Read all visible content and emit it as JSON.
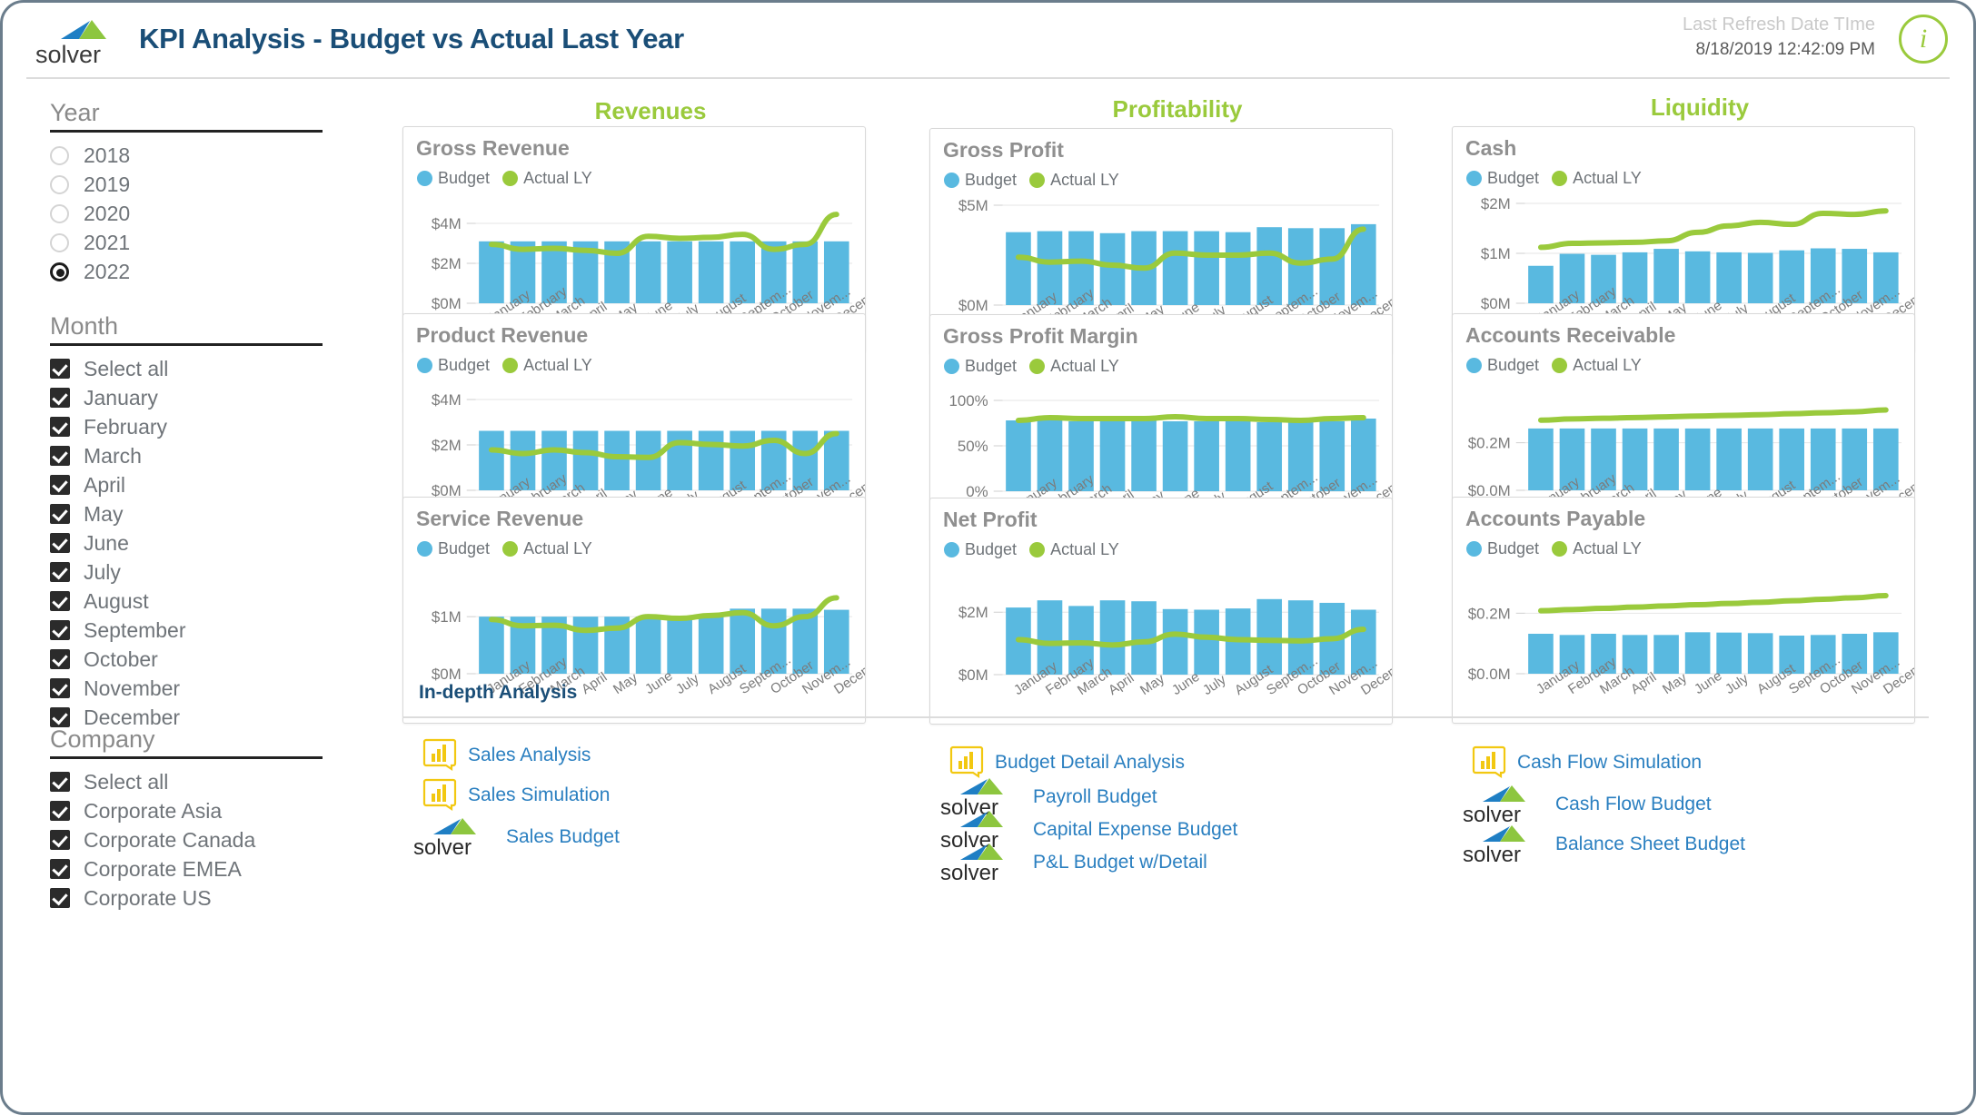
{
  "header": {
    "title": "KPI Analysis - Budget vs Actual Last Year",
    "brand": "solver",
    "refresh_label": "Last Refresh Date TIme",
    "refresh_value": "8/18/2019 12:42:09 PM",
    "info_icon": "info-icon",
    "info_glyph": "i"
  },
  "colors": {
    "budget_bar": "#59B9E0",
    "actual_line": "#9ACA3C",
    "section_header": "#9ACA3C",
    "title_blue": "#1a4e77",
    "link_blue": "#2a7fc0",
    "card_title": "#8f8f8f",
    "powerbi_yellow": "#F2C811"
  },
  "sidebar": {
    "year": {
      "title": "Year",
      "type": "radio",
      "options": [
        {
          "label": "2018",
          "selected": false
        },
        {
          "label": "2019",
          "selected": false
        },
        {
          "label": "2020",
          "selected": false
        },
        {
          "label": "2021",
          "selected": false
        },
        {
          "label": "2022",
          "selected": true
        }
      ]
    },
    "month": {
      "title": "Month",
      "type": "checkbox",
      "options": [
        {
          "label": "Select all",
          "checked": true
        },
        {
          "label": "January",
          "checked": true
        },
        {
          "label": "February",
          "checked": true
        },
        {
          "label": "March",
          "checked": true
        },
        {
          "label": "April",
          "checked": true
        },
        {
          "label": "May",
          "checked": true
        },
        {
          "label": "June",
          "checked": true
        },
        {
          "label": "July",
          "checked": true
        },
        {
          "label": "August",
          "checked": true
        },
        {
          "label": "September",
          "checked": true
        },
        {
          "label": "October",
          "checked": true
        },
        {
          "label": "November",
          "checked": true
        },
        {
          "label": "December",
          "checked": true
        }
      ]
    },
    "company": {
      "title": "Company",
      "type": "checkbox",
      "options": [
        {
          "label": "Select all",
          "checked": true
        },
        {
          "label": "Corporate Asia",
          "checked": true
        },
        {
          "label": "Corporate Canada",
          "checked": true
        },
        {
          "label": "Corporate EMEA",
          "checked": true
        },
        {
          "label": "Corporate US",
          "checked": true
        }
      ]
    }
  },
  "sections": [
    {
      "label": "Revenues"
    },
    {
      "label": "Profitability"
    },
    {
      "label": "Liquidity"
    }
  ],
  "legend": {
    "budget": "Budget",
    "actual": "Actual LY"
  },
  "x_categories": [
    "January",
    "February",
    "March",
    "April",
    "May",
    "June",
    "July",
    "August",
    "Septem...",
    "October",
    "Novem...",
    "Decem..."
  ],
  "chart_data": [
    {
      "id": "gross-revenue",
      "type": "bar",
      "title": "Gross Revenue",
      "section": "Revenues",
      "categories": [
        "January",
        "February",
        "March",
        "April",
        "May",
        "June",
        "July",
        "August",
        "Septem...",
        "October",
        "Novem...",
        "Decem..."
      ],
      "series": [
        {
          "name": "Budget",
          "type": "bar",
          "values": [
            3.1,
            3.1,
            3.1,
            3.1,
            3.1,
            3.1,
            3.1,
            3.1,
            3.1,
            3.1,
            3.1,
            3.1
          ]
        },
        {
          "name": "Actual LY",
          "type": "line",
          "values": [
            2.95,
            2.7,
            2.75,
            2.65,
            2.5,
            3.35,
            3.25,
            3.3,
            3.45,
            2.7,
            2.95,
            4.45
          ]
        }
      ],
      "ylim": [
        0,
        5
      ],
      "yticks": [
        0,
        2,
        4
      ],
      "yticklabels": [
        "$0M",
        "$2M",
        "$4M"
      ],
      "xlabel": "",
      "ylabel": "",
      "grid": true,
      "legend": "top-left"
    },
    {
      "id": "gross-profit",
      "type": "bar",
      "title": "Gross Profit",
      "section": "Profitability",
      "categories": [
        "January",
        "February",
        "March",
        "April",
        "May",
        "June",
        "July",
        "August",
        "Septem...",
        "October",
        "Novem...",
        "Decem..."
      ],
      "series": [
        {
          "name": "Budget",
          "type": "bar",
          "values": [
            3.65,
            3.7,
            3.7,
            3.6,
            3.7,
            3.7,
            3.7,
            3.65,
            3.9,
            3.85,
            3.85,
            4.05
          ]
        },
        {
          "name": "Actual LY",
          "type": "line",
          "values": [
            2.4,
            2.15,
            2.2,
            2.0,
            1.85,
            2.6,
            2.5,
            2.5,
            2.6,
            2.1,
            2.3,
            3.8
          ]
        }
      ],
      "ylim": [
        0,
        5
      ],
      "yticks": [
        0,
        5
      ],
      "yticklabels": [
        "$0M",
        "$5M"
      ],
      "xlabel": "",
      "ylabel": "",
      "grid": true,
      "legend": "top-left"
    },
    {
      "id": "cash",
      "type": "bar",
      "title": "Cash",
      "section": "Liquidity",
      "categories": [
        "January",
        "February",
        "March",
        "April",
        "May",
        "June",
        "July",
        "August",
        "Septem...",
        "October",
        "Novem...",
        "Decem..."
      ],
      "series": [
        {
          "name": "Budget",
          "type": "bar",
          "values": [
            0.75,
            0.99,
            0.97,
            1.02,
            1.09,
            1.04,
            1.02,
            1.01,
            1.06,
            1.1,
            1.09,
            1.02
          ]
        },
        {
          "name": "Actual LY",
          "type": "line",
          "values": [
            1.12,
            1.2,
            1.21,
            1.22,
            1.25,
            1.42,
            1.55,
            1.62,
            1.58,
            1.8,
            1.78,
            1.85
          ]
        }
      ],
      "ylim": [
        0,
        2
      ],
      "yticks": [
        0,
        1,
        2
      ],
      "yticklabels": [
        "$0M",
        "$1M",
        "$2M"
      ],
      "xlabel": "",
      "ylabel": "",
      "grid": true,
      "legend": "top-left"
    },
    {
      "id": "product-revenue",
      "type": "bar",
      "title": "Product Revenue",
      "section": "Revenues",
      "categories": [
        "January",
        "February",
        "March",
        "April",
        "May",
        "June",
        "July",
        "August",
        "Septem...",
        "October",
        "Novem...",
        "Decem..."
      ],
      "series": [
        {
          "name": "Budget",
          "type": "bar",
          "values": [
            2.62,
            2.62,
            2.62,
            2.62,
            2.62,
            2.62,
            2.62,
            2.62,
            2.62,
            2.62,
            2.62,
            2.62
          ]
        },
        {
          "name": "Actual LY",
          "type": "line",
          "values": [
            1.78,
            1.62,
            1.78,
            1.66,
            1.48,
            1.45,
            2.1,
            2.02,
            1.95,
            2.2,
            1.62,
            2.5
          ]
        }
      ],
      "ylim": [
        0,
        4.4
      ],
      "yticks": [
        0,
        2,
        4
      ],
      "yticklabels": [
        "$0M",
        "$2M",
        "$4M"
      ],
      "xlabel": "",
      "ylabel": "",
      "grid": true,
      "legend": "top-left"
    },
    {
      "id": "gross-profit-margin",
      "type": "bar",
      "title": "Gross Profit Margin",
      "section": "Profitability",
      "categories": [
        "January",
        "February",
        "March",
        "April",
        "May",
        "June",
        "July",
        "August",
        "Septem...",
        "October",
        "Novem...",
        "Decem..."
      ],
      "series": [
        {
          "name": "Budget",
          "type": "bar",
          "values": [
            78,
            78,
            77,
            77,
            78,
            77,
            77,
            77,
            76,
            77,
            77,
            80
          ]
        },
        {
          "name": "Actual LY",
          "type": "line",
          "values": [
            78,
            81,
            80,
            80,
            80,
            82,
            80,
            80,
            79,
            78,
            80,
            81
          ]
        }
      ],
      "ylim": [
        0,
        110
      ],
      "yticks": [
        0,
        50,
        100
      ],
      "yticklabels": [
        "0%",
        "50%",
        "100%"
      ],
      "xlabel": "",
      "ylabel": "",
      "grid": true,
      "legend": "top-left"
    },
    {
      "id": "accounts-receivable",
      "type": "bar",
      "title": "Accounts Receivable",
      "section": "Liquidity",
      "categories": [
        "January",
        "February",
        "March",
        "April",
        "May",
        "June",
        "July",
        "August",
        "Septem...",
        "October",
        "Novem...",
        "Decem..."
      ],
      "series": [
        {
          "name": "Budget",
          "type": "bar",
          "values": [
            0.26,
            0.26,
            0.26,
            0.26,
            0.26,
            0.26,
            0.26,
            0.26,
            0.26,
            0.26,
            0.26,
            0.26
          ]
        },
        {
          "name": "Actual LY",
          "type": "line",
          "values": [
            0.295,
            0.3,
            0.303,
            0.306,
            0.309,
            0.312,
            0.315,
            0.318,
            0.322,
            0.326,
            0.33,
            0.338
          ]
        }
      ],
      "ylim": [
        0,
        0.42
      ],
      "yticks": [
        0,
        0.2
      ],
      "yticklabels": [
        "$0.0M",
        "$0.2M"
      ],
      "xlabel": "",
      "ylabel": "",
      "grid": true,
      "legend": "top-left"
    },
    {
      "id": "service-revenue",
      "type": "bar",
      "title": "Service Revenue",
      "section": "Revenues",
      "categories": [
        "January",
        "February",
        "March",
        "April",
        "May",
        "June",
        "July",
        "August",
        "Septem...",
        "October",
        "Novem...",
        "Decem..."
      ],
      "series": [
        {
          "name": "Budget",
          "type": "bar",
          "values": [
            1.0,
            1.0,
            1.0,
            1.0,
            1.0,
            1.0,
            1.0,
            1.0,
            1.14,
            1.14,
            1.14,
            1.12
          ]
        },
        {
          "name": "Actual LY",
          "type": "line",
          "values": [
            0.95,
            0.84,
            0.85,
            0.76,
            0.8,
            1.0,
            0.97,
            1.02,
            1.07,
            0.84,
            1.0,
            1.33
          ]
        }
      ],
      "ylim": [
        0,
        1.75
      ],
      "yticks": [
        0,
        1
      ],
      "yticklabels": [
        "$0M",
        "$1M"
      ],
      "xlabel": "",
      "ylabel": "",
      "grid": true,
      "legend": "top-left"
    },
    {
      "id": "net-profit",
      "type": "bar",
      "title": "Net Profit",
      "section": "Profitability",
      "categories": [
        "January",
        "February",
        "March",
        "April",
        "May",
        "June",
        "July",
        "August",
        "Septem...",
        "October",
        "Novem...",
        "Decem..."
      ],
      "series": [
        {
          "name": "Budget",
          "type": "bar",
          "values": [
            2.15,
            2.38,
            2.2,
            2.38,
            2.35,
            2.1,
            2.08,
            2.12,
            2.42,
            2.38,
            2.3,
            2.08
          ]
        },
        {
          "name": "Actual LY",
          "type": "line",
          "values": [
            1.12,
            1.0,
            1.02,
            0.95,
            1.05,
            1.3,
            1.2,
            1.12,
            1.1,
            1.08,
            1.15,
            1.45
          ]
        }
      ],
      "ylim": [
        0,
        3.2
      ],
      "yticks": [
        0,
        2
      ],
      "yticklabels": [
        "$0M",
        "$2M"
      ],
      "xlabel": "",
      "ylabel": "",
      "grid": true,
      "legend": "top-left"
    },
    {
      "id": "accounts-payable",
      "type": "bar",
      "title": "Accounts Payable",
      "section": "Liquidity",
      "categories": [
        "January",
        "February",
        "March",
        "April",
        "May",
        "June",
        "July",
        "August",
        "Septem...",
        "October",
        "Novem...",
        "Decem..."
      ],
      "series": [
        {
          "name": "Budget",
          "type": "bar",
          "values": [
            0.132,
            0.128,
            0.132,
            0.128,
            0.128,
            0.137,
            0.136,
            0.134,
            0.126,
            0.128,
            0.132,
            0.137
          ]
        },
        {
          "name": "Actual LY",
          "type": "line",
          "values": [
            0.208,
            0.212,
            0.216,
            0.22,
            0.224,
            0.228,
            0.232,
            0.236,
            0.241,
            0.246,
            0.251,
            0.258
          ]
        }
      ],
      "ylim": [
        0,
        0.33
      ],
      "yticks": [
        0,
        0.2
      ],
      "yticklabels": [
        "$0.0M",
        "$0.2M"
      ],
      "xlabel": "",
      "ylabel": "",
      "grid": true,
      "legend": "top-left"
    }
  ],
  "footer": {
    "title": "In-depth Analysis",
    "columns": [
      {
        "links": [
          {
            "label": "Sales  Analysis",
            "icon": "powerbi-icon"
          },
          {
            "label": "Sales Simulation",
            "icon": "powerbi-icon"
          },
          {
            "label": "Sales Budget",
            "icon": "solver-logo-icon"
          }
        ]
      },
      {
        "links": [
          {
            "label": "Budget Detail Analysis",
            "icon": "powerbi-icon"
          },
          {
            "label": "Payroll Budget",
            "icon": "solver-logo-icon"
          },
          {
            "label": "Capital Expense Budget",
            "icon": "solver-logo-icon"
          },
          {
            "label": "P&L Budget w/Detail",
            "icon": "solver-logo-icon"
          }
        ]
      },
      {
        "links": [
          {
            "label": "Cash Flow Simulation",
            "icon": "powerbi-icon"
          },
          {
            "label": "Cash Flow Budget",
            "icon": "solver-logo-icon"
          },
          {
            "label": "Balance Sheet Budget",
            "icon": "solver-logo-icon"
          }
        ]
      }
    ]
  }
}
